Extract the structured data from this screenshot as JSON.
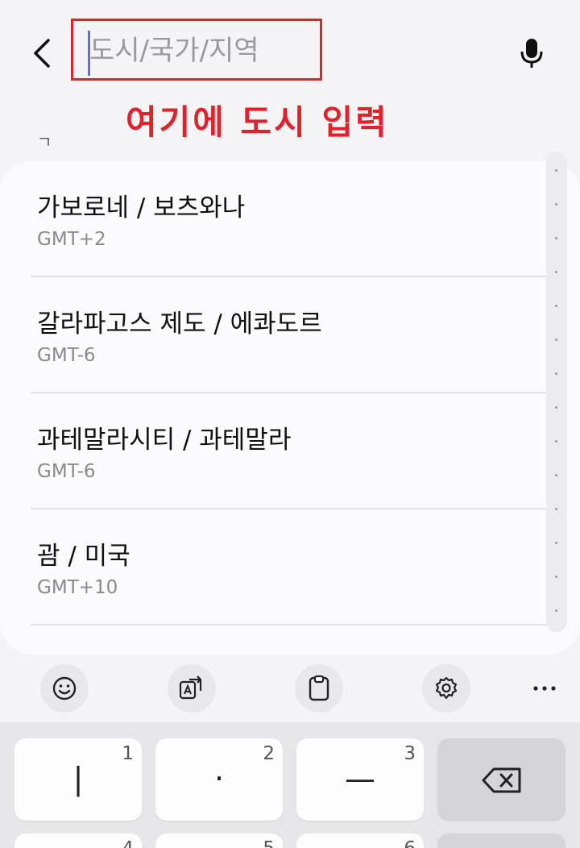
{
  "search": {
    "placeholder": "도시/국가/지역",
    "annotation": "여기에 도시 입력",
    "stray_mark": "ㄱ"
  },
  "results": [
    {
      "name": "가보로네 / 보츠와나",
      "timezone": "GMT+2"
    },
    {
      "name": "갈라파고스 제도 / 에콰도르",
      "timezone": "GMT-6"
    },
    {
      "name": "과테말라시티 / 과테말라",
      "timezone": "GMT-6"
    },
    {
      "name": "괌 / 미국",
      "timezone": "GMT+10"
    }
  ],
  "toolbar": {
    "icons": [
      "emoji-icon",
      "translate-icon",
      "clipboard-icon",
      "settings-icon",
      "more-icon"
    ]
  },
  "keyboard": {
    "row1": [
      {
        "glyph": "|",
        "hint": "1"
      },
      {
        "glyph": "·",
        "hint": "2"
      },
      {
        "glyph": "—",
        "hint": "3"
      }
    ],
    "row2_hints": [
      "4",
      "5",
      "6"
    ]
  },
  "colors": {
    "annotation_red": "#e0222b",
    "cursor": "#6a6ae0",
    "background": "#f4f4f6"
  }
}
